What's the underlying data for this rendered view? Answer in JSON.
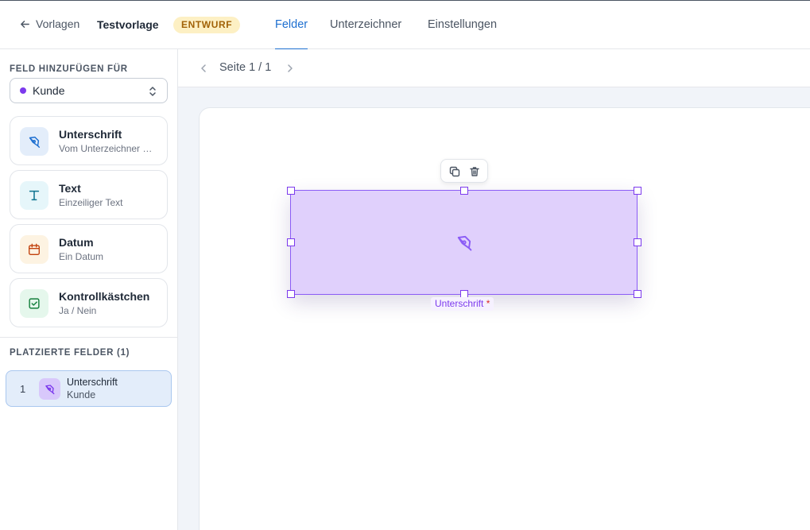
{
  "header": {
    "back_label": "Vorlagen",
    "title": "Testvorlage",
    "status_badge": "ENTWURF",
    "tabs": [
      {
        "label": "Felder",
        "active": true
      },
      {
        "label": "Unterzeichner",
        "active": false
      },
      {
        "label": "Einstellungen",
        "active": false
      }
    ]
  },
  "sidebar": {
    "add_field_title": "FELD HINZUFÜGEN FÜR",
    "signer_select": {
      "value": "Kunde",
      "dot_color": "#7c3aed"
    },
    "field_types": [
      {
        "title": "Unterschrift",
        "subtitle": "Vom Unterzeichner …",
        "icon": "pen-nib-icon",
        "color": "#1d6fd0",
        "bg": "#e3edfa"
      },
      {
        "title": "Text",
        "subtitle": "Einzeiliger Text",
        "icon": "text-t-icon",
        "color": "#0e7490",
        "bg": "#e6f6fa"
      },
      {
        "title": "Datum",
        "subtitle": "Ein Datum",
        "icon": "calendar-icon",
        "color": "#c2410c",
        "bg": "#fdf3e2"
      },
      {
        "title": "Kontrollkästchen",
        "subtitle": "Ja / Nein",
        "icon": "checkbox-icon",
        "color": "#15803d",
        "bg": "#e5f7ec"
      }
    ],
    "placed_title": "PLATZIERTE FELDER (1)",
    "placed_fields": [
      {
        "number": "1",
        "title": "Unterschrift",
        "subtitle": "Kunde",
        "icon": "pen-nib-icon"
      }
    ]
  },
  "main": {
    "page_label": "Seite 1 / 1",
    "field": {
      "label": "Unterschrift",
      "required_mark": "*",
      "color": "#8b5cf6",
      "fill": "#e0d0fc"
    }
  }
}
